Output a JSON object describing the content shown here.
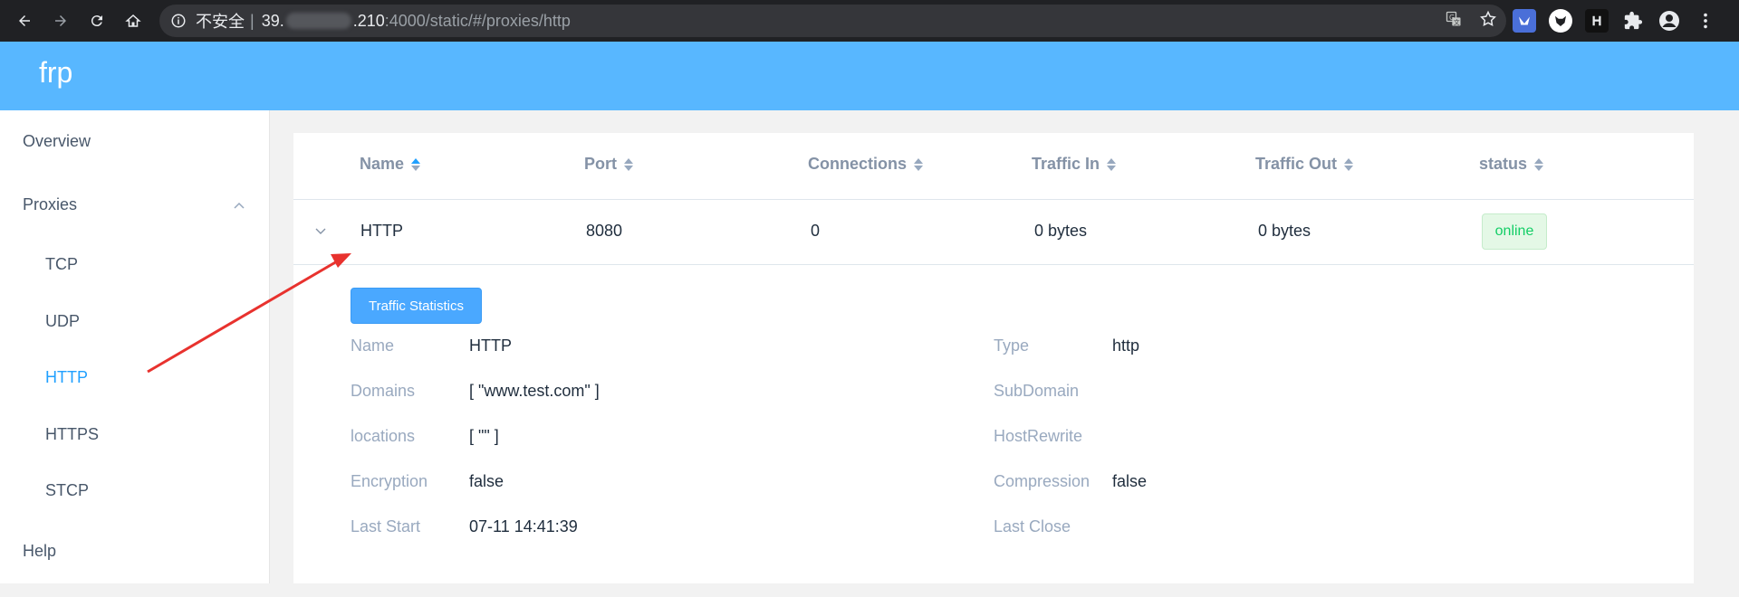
{
  "browser": {
    "security_label": "不安全",
    "separator": "|",
    "host_prefix": "39.",
    "host_suffix": ".210",
    "path": ":4000/static/#/proxies/http",
    "icons": [
      "back-icon",
      "forward-icon",
      "reload-icon",
      "home-icon",
      "info-icon",
      "translate-icon",
      "star-icon",
      "extension-icon",
      "profile-icon",
      "menu-icon"
    ]
  },
  "app": {
    "brand": "frp",
    "header_color": "#58b7ff",
    "accent": "#20a0ff"
  },
  "sidebar": {
    "overview": "Overview",
    "proxies": "Proxies",
    "sub_items": [
      "TCP",
      "UDP",
      "HTTP",
      "HTTPS",
      "STCP"
    ],
    "active": "HTTP",
    "help": "Help"
  },
  "table": {
    "headers": [
      "Name",
      "Port",
      "Connections",
      "Traffic In",
      "Traffic Out",
      "status"
    ],
    "sorted_column": "Name",
    "row": {
      "name": "HTTP",
      "port": "8080",
      "connections": "0",
      "traffic_in": "0 bytes",
      "traffic_out": "0 bytes",
      "status": "online"
    }
  },
  "details": {
    "button": "Traffic Statistics",
    "left": [
      {
        "label": "Name",
        "value": "HTTP"
      },
      {
        "label": "Domains",
        "value": "[ \"www.test.com\" ]"
      },
      {
        "label": "locations",
        "value": "[ \"\" ]"
      },
      {
        "label": "Encryption",
        "value": "false"
      },
      {
        "label": "Last Start",
        "value": "07-11 14:41:39"
      }
    ],
    "right": [
      {
        "label": "Type",
        "value": "http"
      },
      {
        "label": "SubDomain",
        "value": ""
      },
      {
        "label": "HostRewrite",
        "value": ""
      },
      {
        "label": "Compression",
        "value": "false"
      },
      {
        "label": "Last Close",
        "value": ""
      }
    ]
  }
}
